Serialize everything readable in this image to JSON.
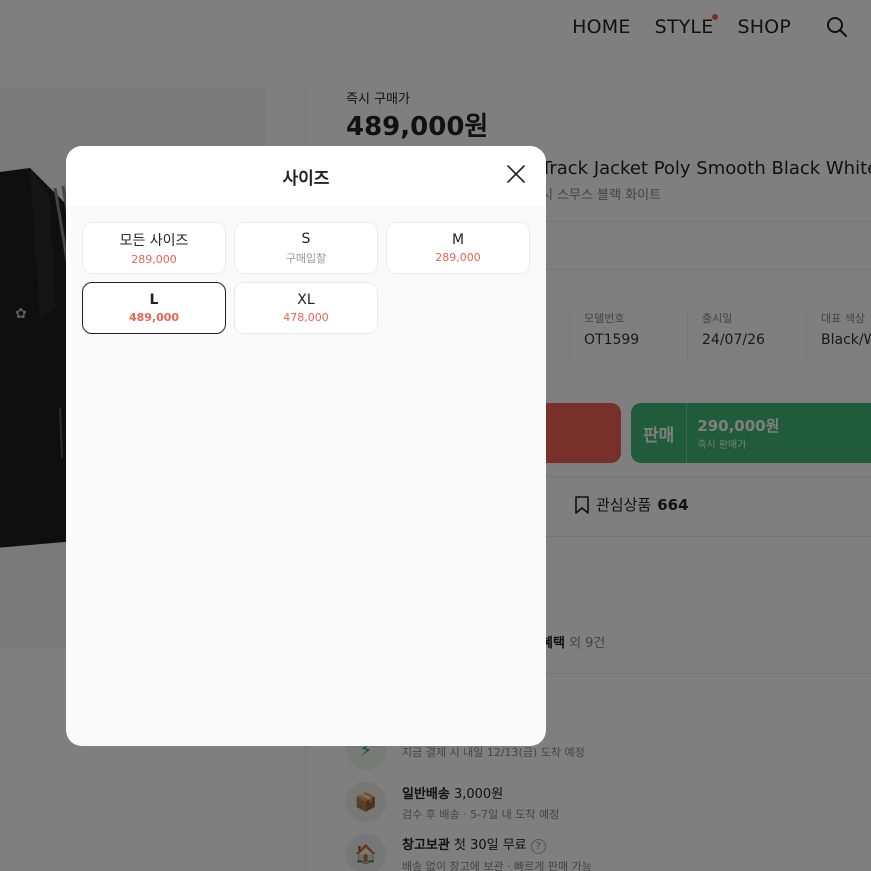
{
  "nav": {
    "items": [
      "HOME",
      "STYLE",
      "SHOP"
    ]
  },
  "product": {
    "price_label": "즉시 구매가",
    "price": "489,000원",
    "name_visible": "Track Jacket Poly Smooth Black White",
    "subname_visible": "시 스무스 블랙 화이트",
    "info": [
      {
        "label": "모델번호",
        "value": "OT1599"
      },
      {
        "label": "출시일",
        "value": "24/07/26"
      },
      {
        "label": "대표 색상",
        "value": "Black/W"
      }
    ],
    "sell_button": {
      "title": "판매",
      "price": "290,000원",
      "label": "즉시 판매가"
    },
    "wishlist": {
      "label": "관심상품",
      "count": "664"
    },
    "benefit": {
      "title": "혜택",
      "more": "외 9건"
    },
    "delivery": [
      {
        "icon": "lightning-icon",
        "title": "",
        "desc": "지금 결제 시 내일 12/13(금) 도착 예정"
      },
      {
        "icon": "box-icon",
        "title": "일반배송",
        "price": "3,000원",
        "desc": "검수 후 배송 · 5-7일 내 도착 예정"
      },
      {
        "icon": "warehouse-icon",
        "title": "창고보관",
        "price": "첫 30일 무료",
        "desc": "배송 없이 창고에 보관 · 빠르게 판매 가능"
      }
    ]
  },
  "modal": {
    "title": "사이즈",
    "sizes": [
      {
        "name": "모든 사이즈",
        "price": "289,000",
        "selected": false,
        "muted": false
      },
      {
        "name": "S",
        "price": "구매입찰",
        "selected": false,
        "muted": true
      },
      {
        "name": "M",
        "price": "289,000",
        "selected": false,
        "muted": false
      },
      {
        "name": "L",
        "price": "489,000",
        "selected": true,
        "muted": false
      },
      {
        "name": "XL",
        "price": "478,000",
        "selected": false,
        "muted": false
      }
    ]
  },
  "colors": {
    "buy": "#ef6253",
    "sell": "#41b979",
    "overlay": "rgba(0,0,0,0.5)"
  }
}
